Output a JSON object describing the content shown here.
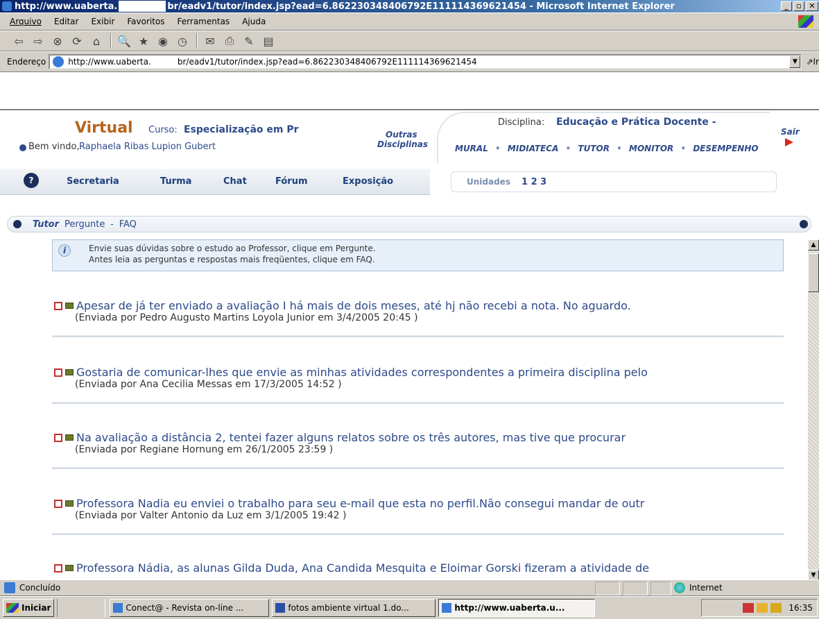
{
  "window": {
    "title_part1": "http://www.uaberta.",
    "title_part2": "br/eadv1/tutor/index.jsp?ead=6.862230348406792E111114369621454 - Microsoft Internet Explorer",
    "min": "_",
    "max": "▫",
    "close": "✕"
  },
  "menu": [
    "Arquivo",
    "Editar",
    "Exibir",
    "Favoritos",
    "Ferramentas",
    "Ajuda"
  ],
  "address": {
    "label": "Endereço",
    "url_part1": "http://www.uaberta.",
    "url_part2": "br/eadv1/tutor/index.jsp?ead=6.862230348406792E111114369621454",
    "go": "Ir"
  },
  "header": {
    "brand": "Virtual",
    "curso_label": "Curso:",
    "curso_value": "Especialização em Pr",
    "welcome_label": "Bem vindo,",
    "welcome_user": "Raphaela Ribas Lupion Gubert",
    "outras1": "Outras",
    "outras2": "Disciplinas",
    "disciplina_label": "Disciplina:",
    "disciplina_value": "Educação e Prática Docente -",
    "sair": "Sair",
    "links": [
      "MURAL",
      "MIDIATECA",
      "TUTOR",
      "MONITOR",
      "DESEMPENHO"
    ],
    "help": "?",
    "tabs": [
      "Secretaria",
      "Turma",
      "Chat",
      "Fórum",
      "Exposição"
    ],
    "unidades_label": "Unidades",
    "unidades_value": "1 2 3"
  },
  "tutorbar": {
    "title": "Tutor",
    "pergunte": "Pergunte",
    "dash": "-",
    "faq": "FAQ"
  },
  "info": {
    "line1": "Envie suas dúvidas sobre o estudo ao Professor, clique em Pergunte.",
    "line2": "Antes leia as perguntas e respostas mais freqüentes, clique em FAQ."
  },
  "questions": [
    {
      "title": "Apesar de já ter enviado a avaliação I há mais de dois meses, até hj não recebi a nota. No aguardo.",
      "meta": "(Enviada por Pedro Augusto Martins Loyola Junior em 3/4/2005 20:45 )"
    },
    {
      "title": "Gostaria de comunicar-lhes que envie as minhas atividades correspondentes a primeira disciplina pelo",
      "meta": "(Enviada por Ana Cecilia Messas em 17/3/2005 14:52 )"
    },
    {
      "title": "Na avaliação a distância 2, tentei fazer alguns relatos sobre os três autores, mas tive que procurar",
      "meta": "(Enviada por Regiane Hornung em 26/1/2005 23:59 )"
    },
    {
      "title": "Professora Nadia eu enviei o trabalho para seu e-mail que esta no perfil.Não consegui mandar de outr",
      "meta": "(Enviada por Valter Antonio da Luz em 3/1/2005 19:42 )"
    },
    {
      "title": "Professora Nádia, as alunas Gilda Duda, Ana Candida Mesquita e Eloimar Gorski fizeram a atividade de",
      "meta": ""
    }
  ],
  "status": {
    "text": "Concluído",
    "zone": "Internet"
  },
  "taskbar": {
    "start": "Iniciar",
    "tasks": [
      "Conect@ - Revista on-line ...",
      "fotos ambiente virtual 1.do...",
      "http://www.uaberta.u..."
    ],
    "clock": "16:35"
  },
  "colors": {
    "titlebar": "#0a246a",
    "link": "#2d4a8a",
    "brand": "#b5651d"
  }
}
